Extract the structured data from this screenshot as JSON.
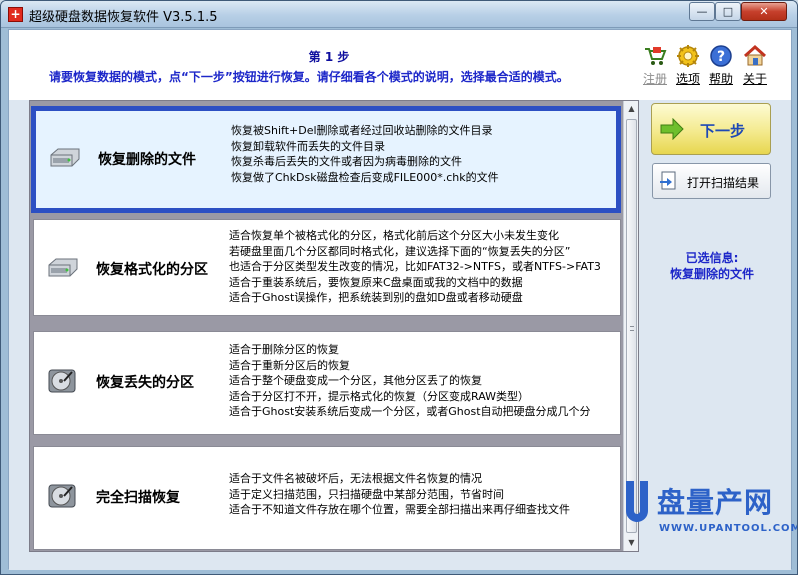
{
  "window": {
    "title": "超级硬盘数据恢复软件 V3.5.1.5",
    "app_icon_glyph": "+",
    "controls": {
      "minimize": "—",
      "maximize": "□",
      "close": "✕"
    }
  },
  "header": {
    "step_title": "第 1 步",
    "step_desc": "请要恢复数据的模式，点“下一步”按钮进行恢复。请仔细看各个模式的说明，选择最合适的模式。"
  },
  "toolbar": {
    "register": "注册",
    "options": "选项",
    "help": "帮助",
    "about": "关于"
  },
  "modes": [
    {
      "name": "恢复删除的文件",
      "icon": "hard-drive-icon",
      "desc": [
        "恢复被Shift+Del删除或者经过回收站删除的文件目录",
        "恢复卸载软件而丢失的文件目录",
        "恢复杀毒后丢失的文件或者因为病毒删除的文件",
        "恢复做了ChkDsk磁盘检查后变成FILE000*.chk的文件"
      ]
    },
    {
      "name": "恢复格式化的分区",
      "icon": "hard-drive-icon",
      "desc": [
        "适合恢复单个被格式化的分区，格式化前后这个分区大小未发生变化",
        "若硬盘里面几个分区都同时格式化，建议选择下面的“恢复丢失的分区”",
        "也适合于分区类型发生改变的情况，比如FAT32->NTFS，或者NTFS->FAT3",
        "适合于重装系统后，要恢复原来C盘桌面或我的文档中的数据",
        "适合于Ghost误操作，把系统装到别的盘如D盘或者移动硬盘"
      ]
    },
    {
      "name": "恢复丢失的分区",
      "icon": "disk-platter-icon",
      "desc": [
        "适合于删除分区的恢复",
        "适合于重新分区后的恢复",
        "适合于整个硬盘变成一个分区，其他分区丢了的恢复",
        "适合于分区打不开，提示格式化的恢复（分区变成RAW类型）",
        "适合于Ghost安装系统后变成一个分区，或者Ghost自动把硬盘分成几个分"
      ]
    },
    {
      "name": "完全扫描恢复",
      "icon": "disk-platter-icon",
      "desc": [
        "适合于文件名被破坏后，无法根据文件名恢复的情况",
        "适于定义扫描范围，只扫描硬盘中某部分范围，节省时间",
        "适合于不知道文件存放在哪个位置，需要全部扫描出来再仔细查找文件"
      ]
    }
  ],
  "buttons": {
    "next": "下一步",
    "open_scan": "打开扫描结果"
  },
  "selected": {
    "label": "已选信息:",
    "value": "恢复删除的文件"
  },
  "watermark": {
    "cn": "盘量产网",
    "url": "WWW.UPANTOOL.COM"
  },
  "colors": {
    "accent_blue": "#1d27c9",
    "selection_border": "#2c4fc3",
    "next_button": "#f4ea8e"
  }
}
